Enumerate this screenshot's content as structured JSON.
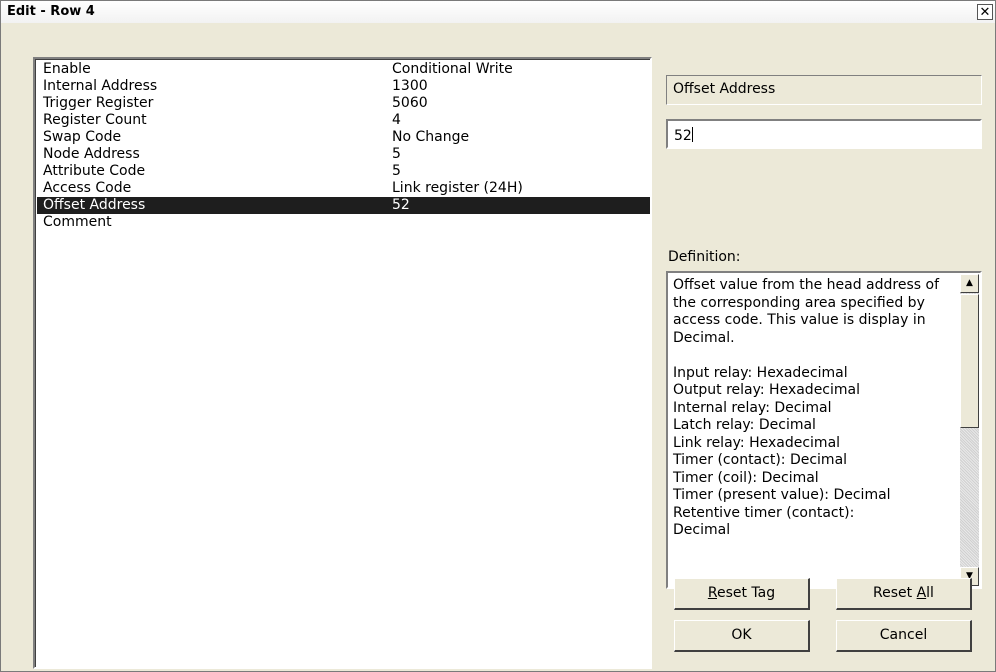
{
  "window": {
    "title": "Edit - Row 4",
    "close_glyph": "✕"
  },
  "properties": [
    {
      "name": "Enable",
      "value": "Conditional Write"
    },
    {
      "name": "Internal Address",
      "value": "1300"
    },
    {
      "name": "Trigger Register",
      "value": "5060"
    },
    {
      "name": "Register Count",
      "value": "4"
    },
    {
      "name": "Swap Code",
      "value": "No Change"
    },
    {
      "name": "Node Address",
      "value": "5"
    },
    {
      "name": "Attribute Code",
      "value": "5"
    },
    {
      "name": "Access Code",
      "value": "Link register (24H)"
    },
    {
      "name": "Offset Address",
      "value": "52",
      "selected": true
    },
    {
      "name": "Comment",
      "value": ""
    }
  ],
  "editor": {
    "field_label": "Offset Address",
    "input_value": "52",
    "definition_label": "Definition:",
    "definition_text": "Offset value from the head address of the corresponding area specified by access code. This value is display in Decimal.\n\nInput relay: Hexadecimal\nOutput relay: Hexadecimal\nInternal relay: Decimal\nLatch relay: Decimal\nLink relay: Hexadecimal\nTimer (contact): Decimal\nTimer (coil): Decimal\nTimer (present value): Decimal\nRetentive timer (contact):\nDecimal"
  },
  "buttons": {
    "reset_tag": {
      "prefix": "",
      "mnemonic": "R",
      "suffix": "eset Tag"
    },
    "reset_all": {
      "prefix": "Reset ",
      "mnemonic": "A",
      "suffix": "ll"
    },
    "ok": "OK",
    "cancel": "Cancel"
  },
  "icons": {
    "close": "close-icon",
    "scroll_up": "scroll-up-arrow-icon",
    "scroll_down": "scroll-down-arrow-icon"
  }
}
